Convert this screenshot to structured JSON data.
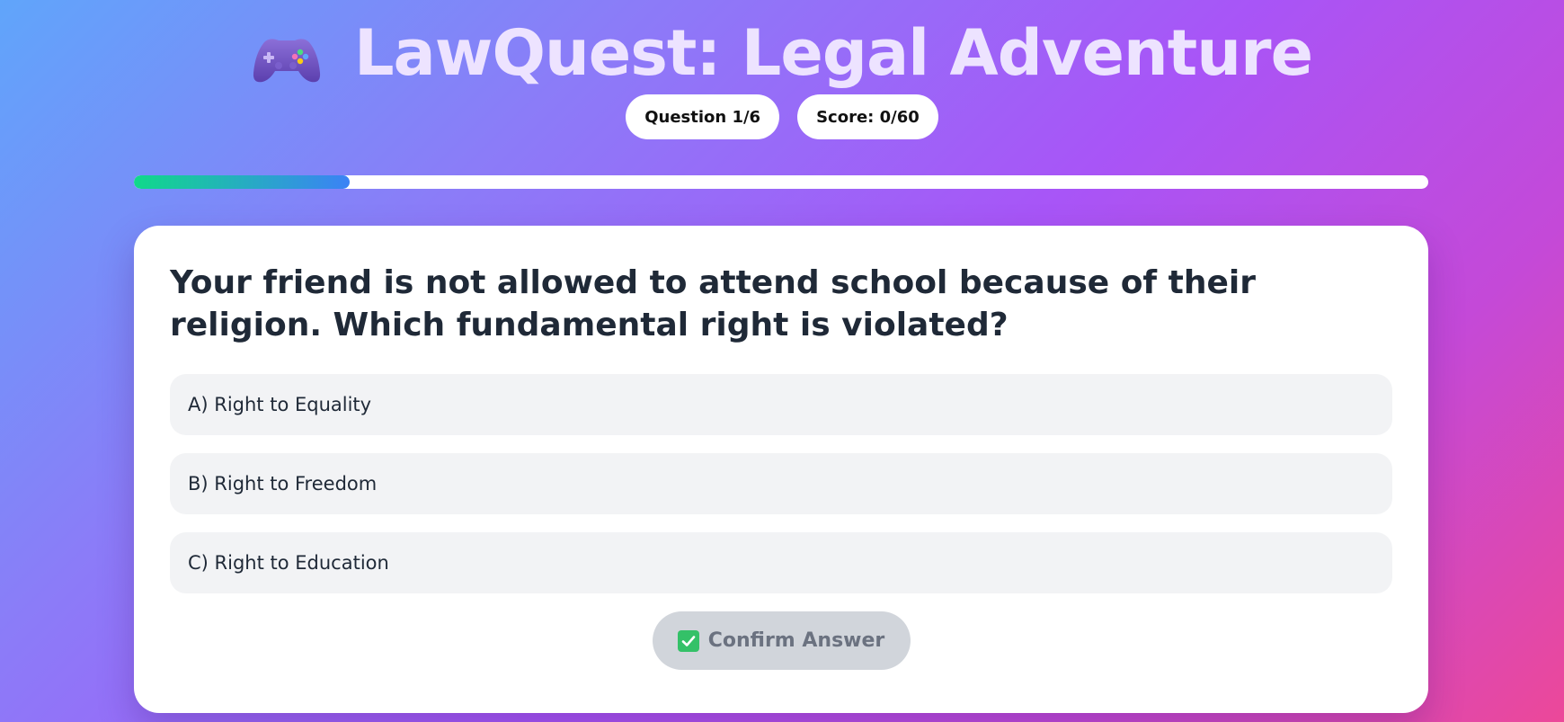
{
  "header": {
    "icon": "game-controller-icon",
    "title": "LawQuest: Legal Adventure"
  },
  "stats": {
    "question": "Question 1/6",
    "score": "Score: 0/60"
  },
  "progress": {
    "fraction": 0.1667,
    "gradient_start": "#10d98a",
    "gradient_end": "#3b82f6"
  },
  "quiz": {
    "question": "Your friend is not allowed to attend school because of their religion. Which fundamental right is violated?",
    "options": [
      {
        "label": "A) Right to Equality"
      },
      {
        "label": "B) Right to Freedom"
      },
      {
        "label": "C) Right to Education"
      }
    ],
    "confirm_icon": "check-box-icon",
    "confirm_label": "Confirm Answer"
  },
  "colors": {
    "background_start": "#60a5fa",
    "background_mid": "#a855f7",
    "background_end": "#ec4899",
    "title": "#ede3ff",
    "question_text": "#1f2937",
    "option_bg": "#f2f3f5",
    "confirm_bg": "#d1d5db",
    "confirm_text": "#6b7280"
  }
}
